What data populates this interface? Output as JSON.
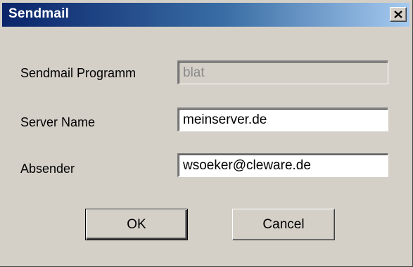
{
  "window": {
    "title": "Sendmail",
    "close_icon": "close-icon"
  },
  "form": {
    "program_label": "Sendmail Programm",
    "program_value": "blat",
    "server_label": "Server Name",
    "server_value": "meinserver.de",
    "sender_label": "Absender",
    "sender_value": "wsoeker@cleware.de"
  },
  "buttons": {
    "ok_label": "OK",
    "cancel_label": "Cancel"
  },
  "colors": {
    "titlebar_start": "#0a246a",
    "titlebar_end": "#a6caf0",
    "face": "#d4d0c8"
  }
}
